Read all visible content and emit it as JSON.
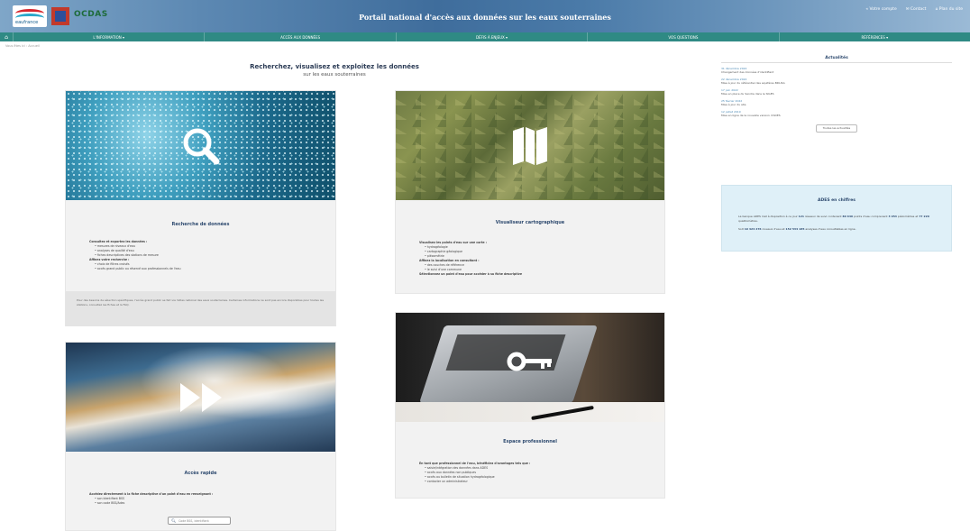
{
  "header": {
    "logo_text": "eaufrance",
    "partner_logo": "OCDAS",
    "portal_title": "Portail national d'accès aux données sur les eaux souterraines",
    "top_links": [
      "« Votre compte",
      "✉ Contact",
      "⌂ Plan du site"
    ]
  },
  "nav": {
    "home_icon": "home-icon",
    "items": [
      "L'INFORMATION ▾",
      "ACCÈS AUX DONNÉES",
      "DÉFIS À ENJEUX ▾",
      "VOS QUESTIONS",
      "RÉFÉRENCES ▾"
    ]
  },
  "breadcrumb": "Vous êtes ici : Accueil",
  "main": {
    "title": "Recherchez, visualisez et exploitez les données",
    "subtitle": "sur les eaux souterraines"
  },
  "cards": {
    "search": {
      "title": "Recherche de données",
      "bullets": [
        {
          "text": "Consultez et exportez les données :",
          "bold": true
        },
        {
          "text": "• mesures de niveaux d'eau",
          "bold": false
        },
        {
          "text": "• analyses de qualité d'eau",
          "bold": false
        },
        {
          "text": "• fiches descriptives des stations de mesure",
          "bold": false
        },
        {
          "text": "Affinez votre recherche :",
          "bold": true
        },
        {
          "text": "• choix de filtres croisés",
          "bold": false
        },
        {
          "text": "• accès grand public ou réservé aux professionnels de l'eau",
          "bold": false
        }
      ],
      "footer": "Pour des besoins de sélection spécifiques, l'accès grand public se fait via l'atlas national des eaux souterraines. Certaines informations ne sont pas encore disponibles pour toutes les stations, consultez les fiches et la FAQ."
    },
    "viewer": {
      "title": "Visualiseur cartographique",
      "bullets": [
        {
          "text": "Visualisez les points d'eau sur une carte :",
          "bold": true
        },
        {
          "text": "• hydrogéologie",
          "bold": false
        },
        {
          "text": "• cartographie géologique",
          "bold": false
        },
        {
          "text": "• piézométrie",
          "bold": false
        },
        {
          "text": "Affinez la localisation en consultant :",
          "bold": true
        },
        {
          "text": "• des couches de référence",
          "bold": false
        },
        {
          "text": "• le suivi d'une commune",
          "bold": false
        },
        {
          "text": "Sélectionnez un point d'eau pour accéder à sa fiche descriptive",
          "bold": true
        }
      ]
    },
    "quick": {
      "title": "Accès rapide",
      "bullets": [
        {
          "text": "Accédez directement à la fiche descriptive d'un point d'eau en renseignant :",
          "bold": true
        },
        {
          "text": "• son identifiant BSS",
          "bold": false
        },
        {
          "text": "• son code BSS/Ades",
          "bold": false
        }
      ],
      "search_placeholder": "Code BSS, identifiant"
    },
    "pro": {
      "title": "Espace professionnel",
      "bullets": [
        {
          "text": "En tant que professionnel de l'eau, bénéficiez d'avantages tels que :",
          "bold": true
        },
        {
          "text": "• saisie/intégration des données dans ADES",
          "bold": false
        },
        {
          "text": "• accès aux données non publiques",
          "bold": false
        },
        {
          "text": "• accès au bulletin de situation hydrogéologique",
          "bold": false
        },
        {
          "text": "• contacter un administrateur",
          "bold": false
        }
      ]
    }
  },
  "news": {
    "title": "Actualités",
    "entries": [
      {
        "date": "31 décembre 2022",
        "text": "Changement des données d'identifiant"
      },
      {
        "date": "22 décembre 2022",
        "text": "Mise à jour du référentiel des aquifères BDLISA"
      },
      {
        "date": "17 juin 2022",
        "text": "Mise en place du Sandre dans le SIGES"
      },
      {
        "date": "25 février 2022",
        "text": "Mise à jour du site"
      },
      {
        "date": "12 juillet 2019",
        "text": "Mise en ligne de la nouvelle version d'ADES"
      }
    ],
    "all_button": "Toutes les actualités"
  },
  "ades_numbers": {
    "title": "ADES en chiffres",
    "line1_pre": "La banque ADES met à disposition à ce jour ",
    "line1_n1": "121",
    "line1_mid": " réseaux de suivi contenant ",
    "line1_n2": "80 649",
    "line1_mid2": " points d'eau comprenant ",
    "line1_n3": "3 954",
    "line1_mid3": " piézomètres et ",
    "line1_n4": "77 220",
    "line1_post": " qualitomètres.",
    "line2_pre": "Soit ",
    "line2_n1": "19 424 276",
    "line2_mid": " niveaux d'eau et ",
    "line2_n2": "152 534 185",
    "line2_post": " analyses d'eau consultables en ligne."
  },
  "colors": {
    "nav": "#2f8a84",
    "title_blue": "#2e4a6f",
    "info_bg": "#dff0f8"
  }
}
